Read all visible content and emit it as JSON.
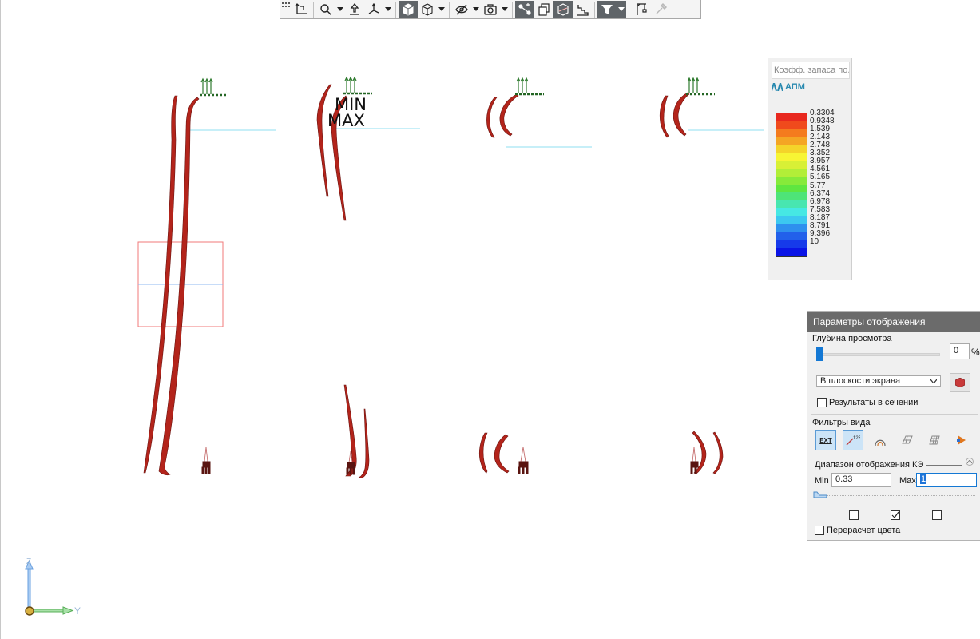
{
  "toolbar": {
    "buttons": [
      {
        "icon": "toolbar-grip-icon",
        "active": false
      },
      {
        "icon": "axes-corner-icon",
        "active": false
      },
      {
        "icon": "zoom-icon",
        "active": false,
        "dropdown": true
      },
      {
        "icon": "pan-icon",
        "active": false
      },
      {
        "icon": "rotate-axes-icon",
        "active": false,
        "dropdown": true
      },
      {
        "icon": "solid-cube-icon",
        "active": true
      },
      {
        "icon": "wire-cube-icon",
        "active": false,
        "dropdown": true
      },
      {
        "icon": "visibility-icon",
        "active": false,
        "dropdown": true
      },
      {
        "icon": "camera-icon",
        "active": false,
        "dropdown": true
      },
      {
        "icon": "node-link-icon",
        "active": true
      },
      {
        "icon": "copy-pages-icon",
        "active": false
      },
      {
        "icon": "section-cube-icon",
        "active": true
      },
      {
        "icon": "stairs-icon",
        "active": false
      },
      {
        "icon": "filter-icon",
        "active": true,
        "dropdown": true
      },
      {
        "icon": "crane-icon",
        "active": false
      },
      {
        "icon": "pipette-icon",
        "active": false
      }
    ]
  },
  "scene": {
    "min_label": "MIN",
    "max_label": "MAX",
    "member_color": "#b3241b",
    "support_color": "#2e7a2e"
  },
  "legend": {
    "title": "Коэфф. запаса по...",
    "logo": "АПМ",
    "colors": [
      "#e8281e",
      "#f04a1c",
      "#f47b1e",
      "#f4a524",
      "#f4d42a",
      "#f7f534",
      "#d8f036",
      "#b2ee38",
      "#86ea3a",
      "#5ee640",
      "#4ee478",
      "#48e6b0",
      "#46e8e4",
      "#3cc8f0",
      "#2e90ee",
      "#2260ea",
      "#163aea",
      "#0a14e6"
    ],
    "labels": [
      "0.3304",
      "0.9348",
      "1.539",
      "2.143",
      "2.748",
      "3.352",
      "3.957",
      "4.561",
      "5.165",
      "5.77",
      "6.374",
      "6.978",
      "7.583",
      "8.187",
      "8.791",
      "9.396",
      "10"
    ]
  },
  "panel": {
    "header": "Параметры отображения",
    "depth_label": "Глубина просмотра",
    "depth_value": "0",
    "depth_unit": "%",
    "plane_select": "В плоскости экрана",
    "section_results_label": "Результаты в сечении",
    "view_filters_label": "Фильтры вида",
    "filters": [
      {
        "icon": "ext-filter-icon",
        "text": "EXT",
        "active": true
      },
      {
        "icon": "numbering-filter-icon",
        "text": "123",
        "active": true
      },
      {
        "icon": "arch-filter-icon",
        "active": false
      },
      {
        "icon": "shell-filter-icon",
        "active": false
      },
      {
        "icon": "mesh-filter-icon",
        "active": false
      },
      {
        "icon": "color-filter-icon",
        "active": false
      }
    ],
    "range_label": "Диапазон отображения КЭ",
    "min_label": "Min",
    "min_value": "0.33",
    "max_label": "Max",
    "max_value": "1",
    "range_checks": [
      false,
      true,
      false
    ],
    "recalc_label": "Перерасчет цвета"
  },
  "axes": {
    "z": "Z",
    "y": "Y"
  }
}
